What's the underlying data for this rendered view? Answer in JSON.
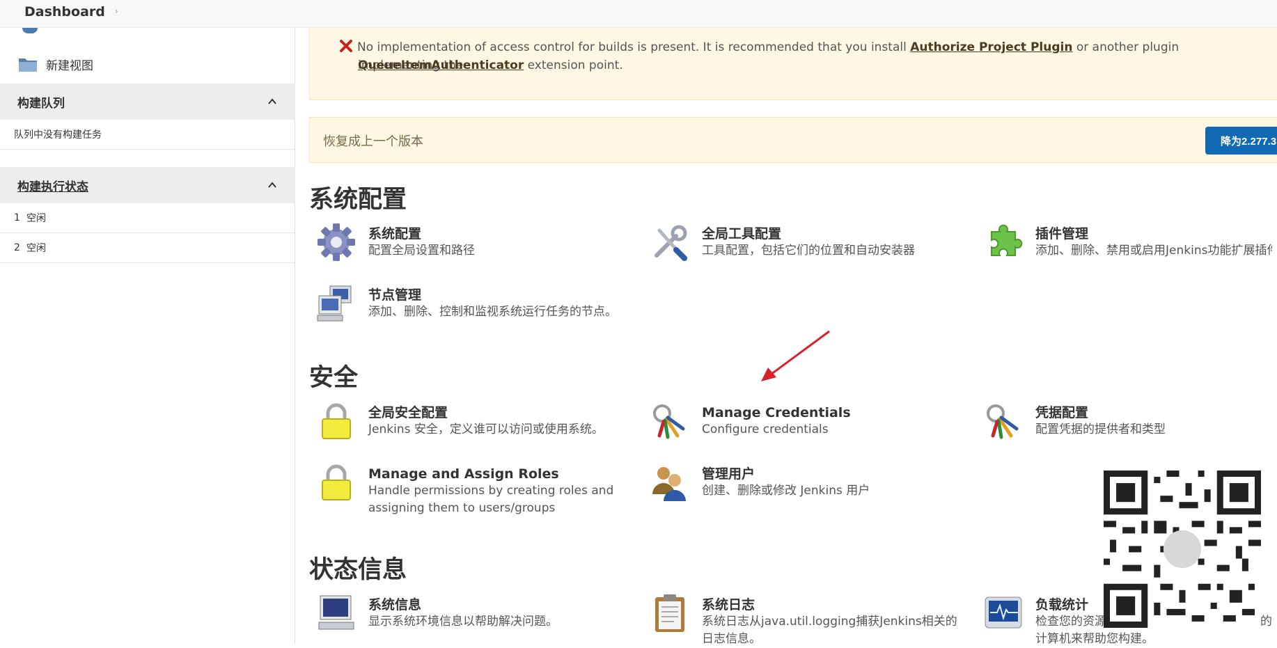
{
  "breadcrumb": {
    "root": "Dashboard",
    "separator": "›"
  },
  "sidebar": {
    "new_view": "新建视图",
    "build_queue": {
      "title": "构建队列",
      "empty": "队列中没有构建任务"
    },
    "executors": {
      "title": "构建执行状态",
      "rows": [
        {
          "num": "1",
          "status": "空闲"
        },
        {
          "num": "2",
          "status": "空闲"
        }
      ]
    }
  },
  "alert": {
    "text_before": "No implementation of access control for builds is present. It is recommended that you install ",
    "link1": "Authorize Project Plugin",
    "text_mid": " or another plugin implementing the",
    "link2": "QueueItemAuthenticator",
    "text_after": " extension point."
  },
  "restore": {
    "label": "恢复成上一个版本",
    "button": "降为2.277.3"
  },
  "sections": {
    "system": {
      "title": "系统配置",
      "items": [
        {
          "name": "系统配置",
          "desc": "配置全局设置和路径",
          "icon": "gear-icon"
        },
        {
          "name": "全局工具配置",
          "desc": "工具配置，包括它们的位置和自动安装器",
          "icon": "tools-icon"
        },
        {
          "name": "插件管理",
          "desc": "添加、删除、禁用或启用Jenkins功能扩展插件。",
          "icon": "puzzle-icon"
        },
        {
          "name": "节点管理",
          "desc": "添加、删除、控制和监视系统运行任务的节点。",
          "icon": "computers-icon"
        }
      ]
    },
    "security": {
      "title": "安全",
      "items": [
        {
          "name": "全局安全配置",
          "desc": "Jenkins 安全，定义谁可以访问或使用系统。",
          "icon": "lock-icon"
        },
        {
          "name": "Manage Credentials",
          "desc": "Configure credentials",
          "icon": "keys-icon"
        },
        {
          "name": "凭据配置",
          "desc": "配置凭据的提供者和类型",
          "icon": "keys-icon"
        },
        {
          "name": "Manage and Assign Roles",
          "desc": "Handle permissions by creating roles and assigning them to users/groups",
          "icon": "lock-icon"
        },
        {
          "name": "管理用户",
          "desc": "创建、删除或修改 Jenkins 用户",
          "icon": "users-icon"
        }
      ]
    },
    "status": {
      "title": "状态信息",
      "items": [
        {
          "name": "系统信息",
          "desc": "显示系统环境信息以帮助解决问题。",
          "icon": "computer-icon"
        },
        {
          "name": "系统日志",
          "desc": "系统日志从java.util.logging捕获Jenkins相关的日志信息。",
          "icon": "clipboard-icon"
        },
        {
          "name": "负载统计",
          "desc": "检查您的资源利用情况，看看是否需要更多的计算机来帮助您构建。",
          "icon": "monitor-icon"
        }
      ]
    }
  },
  "colors": {
    "accent_button": "#1169b3",
    "alert_bg": "#fdf7e3",
    "annotation_arrow": "#d9212a"
  }
}
